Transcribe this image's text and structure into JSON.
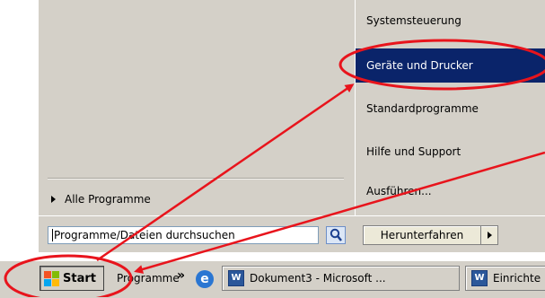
{
  "start_menu": {
    "all_programs_label": "Alle Programme",
    "right_items": [
      {
        "label": "Systemsteuerung"
      },
      {
        "label": "Geräte und Drucker"
      },
      {
        "label": "Standardprogramme"
      },
      {
        "label": "Hilfe und Support"
      },
      {
        "label": "Ausführen..."
      }
    ],
    "search": {
      "placeholder": "Programme/Dateien durchsuchen",
      "icon": "magnifier-icon"
    },
    "shutdown_label": "Herunterfahren"
  },
  "taskbar": {
    "start_label": "Start",
    "programs_label": "Programme",
    "chevron": "»",
    "tasks": [
      {
        "label": "Dokument3 - Microsoft ..."
      },
      {
        "label": "Einrichte"
      }
    ]
  },
  "colors": {
    "highlight": "#0a246a",
    "annotation_red": "#e8141c",
    "menu_gray": "#d4d0c8"
  }
}
